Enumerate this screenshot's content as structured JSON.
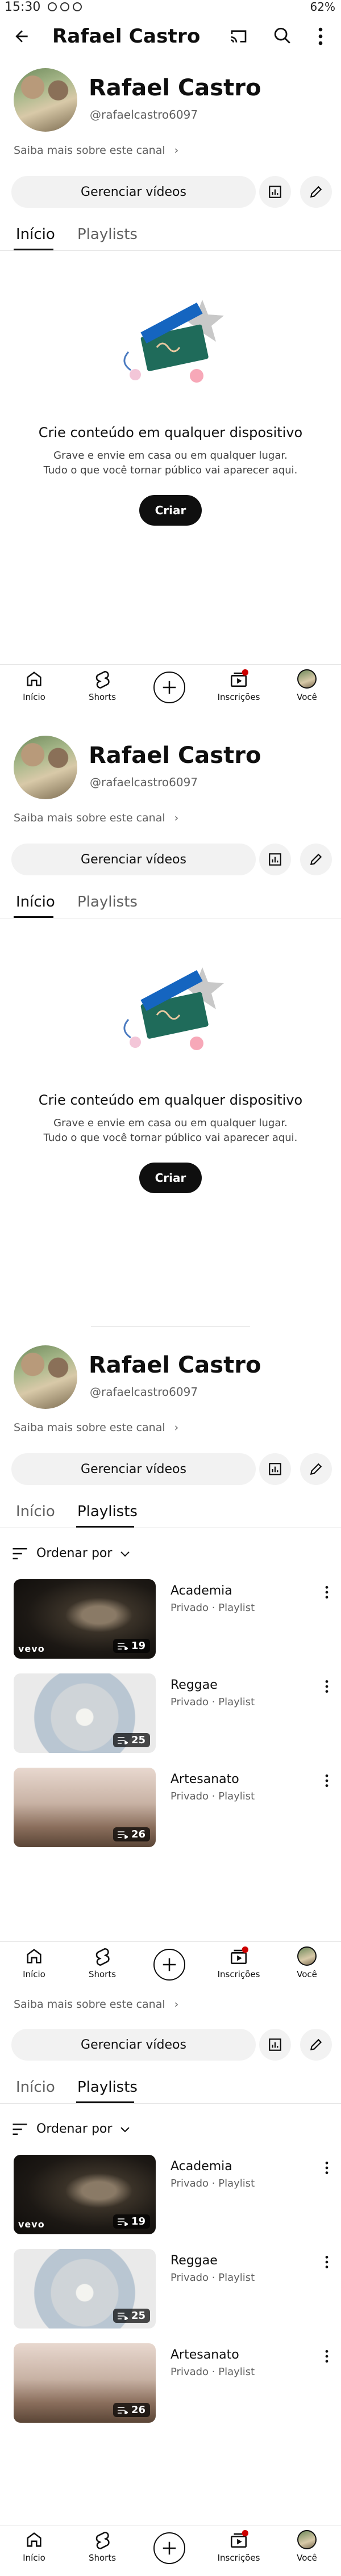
{
  "status_bar": {
    "time": "15:30",
    "battery": "62%"
  },
  "header": {
    "title": "Rafael Castro"
  },
  "channel": {
    "name": "Rafael Castro",
    "handle": "@rafaelcastro6097",
    "more_about": "Saiba mais sobre este canal",
    "manage_videos": "Gerenciar vídeos"
  },
  "tabs": {
    "home": "Início",
    "playlists": "Playlists"
  },
  "empty_state": {
    "title": "Crie conteúdo em qualquer dispositivo",
    "line1": "Grave e envie em casa ou em qualquer lugar.",
    "line2": "Tudo o que você tornar público vai aparecer aqui.",
    "create_button": "Criar"
  },
  "sort": {
    "label": "Ordenar por"
  },
  "playlists": [
    {
      "title": "Academia",
      "meta": "Privado · Playlist",
      "count": "19"
    },
    {
      "title": "Reggae",
      "meta": "Privado · Playlist",
      "count": "25"
    },
    {
      "title": "Artesanato",
      "meta": "Privado · Playlist",
      "count": "26"
    }
  ],
  "thumb_overlay": {
    "vevo": "vevo"
  },
  "bottom_nav": {
    "home": "Início",
    "shorts": "Shorts",
    "subscriptions": "Inscrições",
    "you": "Você"
  }
}
